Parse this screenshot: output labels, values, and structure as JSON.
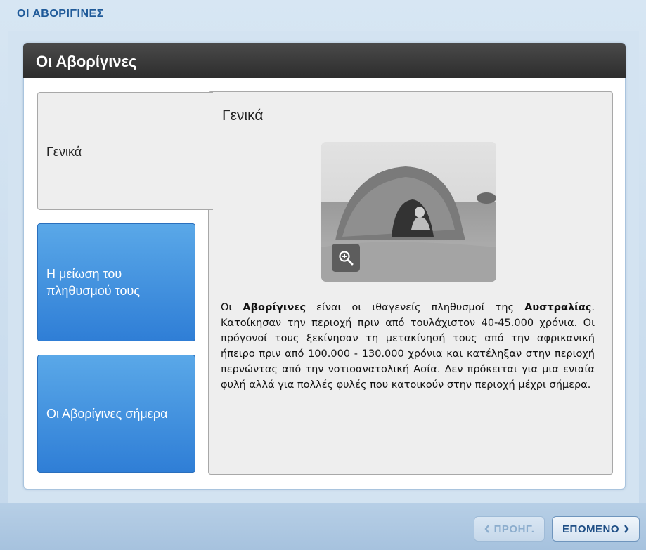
{
  "app": {
    "top_title": "ΟΙ ΑΒΟΡΙΓΙΝΕΣ"
  },
  "card": {
    "title": "Οι Αβορίγινες"
  },
  "tabs": [
    {
      "label": "Γενικά",
      "active": true
    },
    {
      "label": "Η μείωση του πληθυσμού τους",
      "active": false
    },
    {
      "label": "Οι Αβορίγινες σήμερα",
      "active": false
    }
  ],
  "content": {
    "section_title": "Γενικά",
    "image_icon": "zoom-in-icon",
    "paragraph": {
      "p1": "Οι ",
      "b1": "Αβορίγινες",
      "p2": " είναι οι ιθαγενείς πληθυσμοί της ",
      "b2": "Αυστραλίας",
      "p3": ". Κατοίκησαν την περιοχή πριν από τουλάχιστον 40-45.000 χρόνια. Οι πρόγονοί τους ξεκίνησαν τη μετακίνησή τους από την αφρικανική ήπειρο πριν από 100.000 - 130.000 χρόνια και κατέληξαν στην περιοχή περνώντας από την νοτιοανατολική Ασία. Δεν πρόκειται για μια ενιαία φυλή αλλά για πολλές φυλές που κατοικούν στην περιοχή μέχρι σήμερα."
    }
  },
  "navigation": {
    "prev_label": "ΠΡΟΗΓ.",
    "next_label": "ΕΠΟΜΕΝΟ",
    "prev_enabled": false,
    "next_enabled": true
  },
  "colors": {
    "header_bg": "#3a3a3a",
    "tab_blue": "#3a8ee0",
    "title_blue": "#1f5a99"
  }
}
